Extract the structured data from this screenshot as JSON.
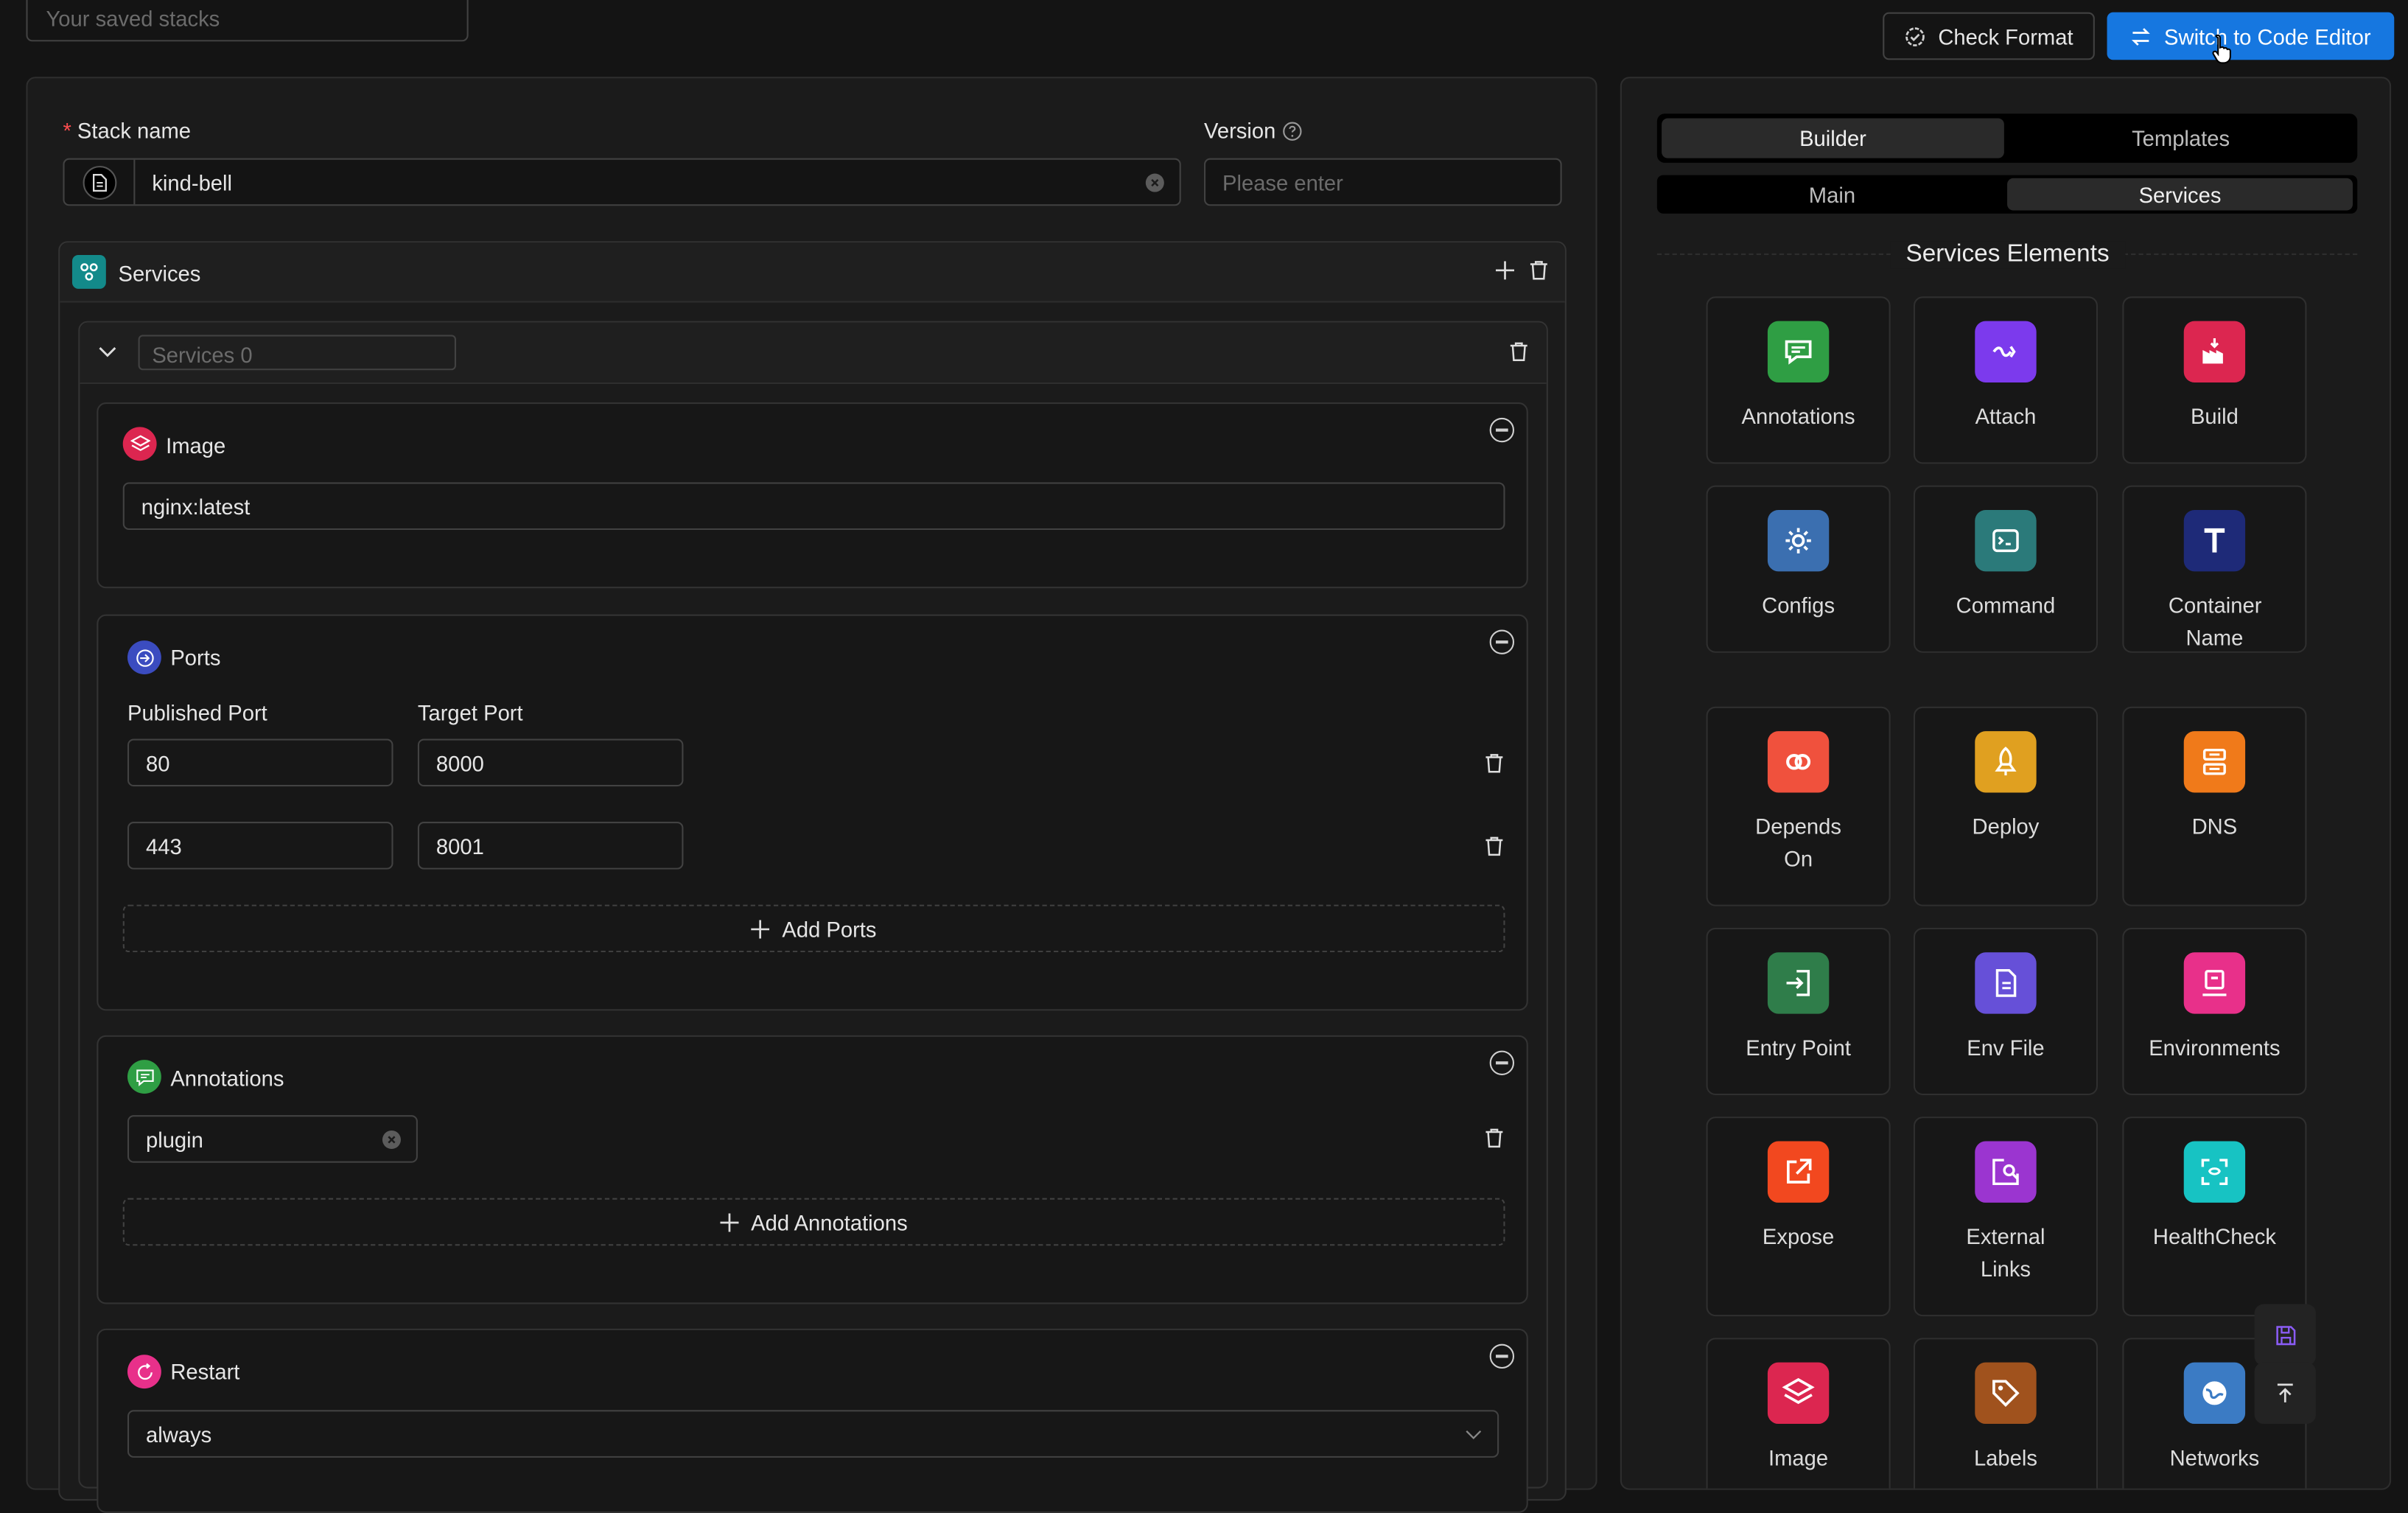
{
  "top": {
    "saved_stacks_placeholder": "Your saved stacks",
    "check_format_label": "Check Format",
    "switch_label": "Switch to Code Editor"
  },
  "form": {
    "stack_name_required_mark": "*",
    "stack_name_label": "Stack name",
    "stack_name_value": "kind-bell",
    "version_label": "Version",
    "version_placeholder": "Please enter"
  },
  "services": {
    "title": "Services",
    "service_name_placeholder": "Services 0",
    "image": {
      "title": "Image",
      "value": "nginx:latest"
    },
    "ports": {
      "title": "Ports",
      "published_label": "Published Port",
      "target_label": "Target Port",
      "rows": [
        {
          "published": "80",
          "target": "8000"
        },
        {
          "published": "443",
          "target": "8001"
        }
      ],
      "add_label": "Add Ports"
    },
    "annotations": {
      "title": "Annotations",
      "value": "plugin",
      "add_label": "Add Annotations"
    },
    "restart": {
      "title": "Restart",
      "value": "always"
    }
  },
  "sidebar": {
    "tabs": [
      "Builder",
      "Templates"
    ],
    "active_tab": "Builder",
    "subtabs": [
      "Main",
      "Services"
    ],
    "active_subtab": "Services",
    "section_title": "Services Elements",
    "elements": [
      {
        "label": "Annotations",
        "icon": "message-icon",
        "color": "#2f9e44"
      },
      {
        "label": "Attach",
        "icon": "link-icon",
        "color": "#7c3aed"
      },
      {
        "label": "Build",
        "icon": "factory-icon",
        "color": "#dc2650"
      },
      {
        "label": "Configs",
        "icon": "gear-icon",
        "color": "#3b6fb0"
      },
      {
        "label": "Command",
        "icon": "terminal-icon",
        "color": "#2b7a7a"
      },
      {
        "label": "Container Name",
        "icon": "text-t-icon",
        "color": "#1e2a78"
      },
      {
        "label": "Depends On",
        "icon": "chain-icon",
        "color": "#f0513d"
      },
      {
        "label": "Deploy",
        "icon": "rocket-icon",
        "color": "#e0a020"
      },
      {
        "label": "DNS",
        "icon": "server-icon",
        "color": "#f07a1a"
      },
      {
        "label": "Entry Point",
        "icon": "login-icon",
        "color": "#2f7d4a"
      },
      {
        "label": "Env File",
        "icon": "file-icon",
        "color": "#6650d8"
      },
      {
        "label": "Environments",
        "icon": "monitor-icon",
        "color": "#e8308a"
      },
      {
        "label": "Expose",
        "icon": "external-icon",
        "color": "#f2481f"
      },
      {
        "label": "External Links",
        "icon": "link-search-icon",
        "color": "#9b35d0"
      },
      {
        "label": "HealthCheck",
        "icon": "scan-icon",
        "color": "#17c3c3"
      },
      {
        "label": "Image",
        "icon": "layers-icon",
        "color": "#dc2650"
      },
      {
        "label": "Labels",
        "icon": "tag-icon",
        "color": "#a0521d"
      },
      {
        "label": "Networks",
        "icon": "globe-icon",
        "color": "#3b7bc4"
      }
    ]
  }
}
